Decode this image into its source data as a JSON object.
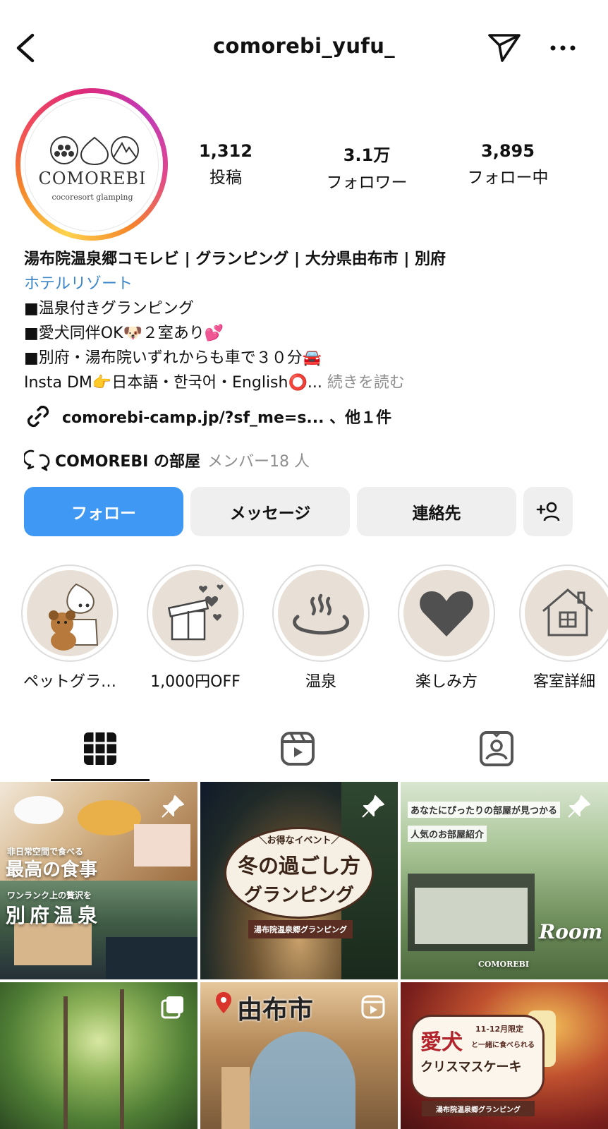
{
  "header": {
    "username": "comorebi_yufu_",
    "back_icon": "chevron-left-icon",
    "send_icon": "paper-plane-icon",
    "more_icon": "ellipsis-icon"
  },
  "avatar": {
    "logo_text": "COMOREBI",
    "logo_sub": "cocoresort glamping"
  },
  "stats": [
    {
      "value": "1,312",
      "label": "投稿"
    },
    {
      "value": "3.1万",
      "label": "フォロワー"
    },
    {
      "value": "3,895",
      "label": "フォロー中"
    }
  ],
  "bio": {
    "name": "湯布院温泉郷コモレビ | グランピング | 大分県由布市 | 別府",
    "category": "ホテルリゾート",
    "lines": [
      "■温泉付きグランピング",
      "■愛犬同伴OK🐶２室あり💕",
      "■別府・湯布院いずれからも車で３０分🚘",
      "Insta DM👉日本語・한국어・English⭕..."
    ],
    "read_more": "続きを読む"
  },
  "link": {
    "text": "comorebi-camp.jp/?sf_me=s... 、他１件",
    "icon": "link-icon"
  },
  "channel": {
    "name": "COMOREBI の部屋",
    "members": "メンバー18 人",
    "icon": "broadcast-channel-icon"
  },
  "buttons": {
    "follow": "フォロー",
    "message": "メッセージ",
    "contact": "連絡先",
    "add_user_icon": "add-person-icon"
  },
  "highlights": [
    {
      "label": "ペットグラ…"
    },
    {
      "label": "1,000円OFF"
    },
    {
      "label": "温泉"
    },
    {
      "label": "楽しみ方"
    },
    {
      "label": "客室詳細"
    }
  ],
  "tabs": [
    {
      "name": "grid",
      "icon": "grid-icon",
      "active": true
    },
    {
      "name": "reels",
      "icon": "reels-icon",
      "active": false
    },
    {
      "name": "tagged",
      "icon": "tagged-person-icon",
      "active": false
    }
  ],
  "posts": [
    {
      "texts": [
        "非日常空間で食べる",
        "最高の食事",
        "ワンランク上の贅沢を",
        "別府温泉"
      ],
      "pinned": true
    },
    {
      "texts": [
        "＼お得なイベント／",
        "冬の過ごし方",
        "グランピング",
        "湯布院温泉郷グランピング"
      ],
      "pinned": true
    },
    {
      "texts": [
        "あなたにぴったりの部屋が見つかる",
        "人気のお部屋紹介",
        "Room",
        "COMOREBI"
      ],
      "pinned": true
    },
    {
      "texts": [],
      "type": "carousel"
    },
    {
      "texts": [
        "由布市"
      ],
      "type": "reel"
    },
    {
      "texts": [
        "愛犬",
        "11-12月限定",
        "と一緒に食べられる",
        "クリスマスケーキ",
        "湯布院温泉郷グランピング"
      ]
    }
  ],
  "colors": {
    "follow_blue": "#3e98f4",
    "link_blue": "#3a85c8",
    "muted_gray": "#8e8e8e",
    "button_gray": "#efefef",
    "highlight_beige": "#e8e0d6"
  }
}
